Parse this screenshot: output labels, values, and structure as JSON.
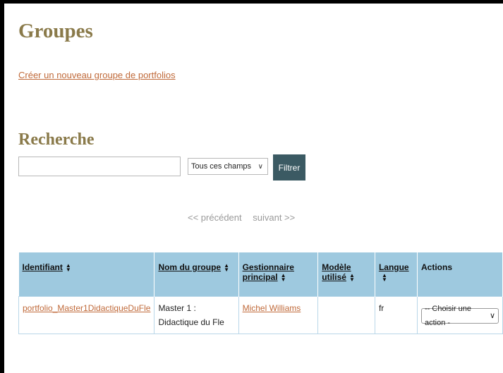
{
  "page": {
    "title": "Groupes",
    "create_link": "Créer un nouveau groupe de portfolios"
  },
  "search": {
    "title": "Recherche",
    "query_value": "",
    "field_selected": "Tous ces champs",
    "filter_label": "Filtrer"
  },
  "pager": {
    "previous": "<< précédent",
    "next": "suivant >>"
  },
  "table": {
    "columns": [
      {
        "label": "Identifiant",
        "sortable": true
      },
      {
        "label": "Nom du groupe",
        "sortable": true
      },
      {
        "label": "Gestionnaire principal",
        "sortable": true
      },
      {
        "label": "Modèle utilisé",
        "sortable": true
      },
      {
        "label": "Langue",
        "sortable": true
      },
      {
        "label": "Actions",
        "sortable": false
      }
    ],
    "rows": [
      {
        "identifiant": "portfolio_Master1DidactiqueDuFle",
        "nom": "Master 1 : Didactique du Fle",
        "gestionnaire": "Michel Williams",
        "modele": "",
        "langue": "fr",
        "action": "-- Choisir une action -"
      }
    ]
  },
  "colors": {
    "heading": "#8a7a4a",
    "link": "#c06a3a",
    "button": "#3b5a63",
    "table_header": "#9ec9df"
  },
  "icons": {
    "sort": "sort-arrows-icon",
    "select": "chevron-down-icon"
  }
}
